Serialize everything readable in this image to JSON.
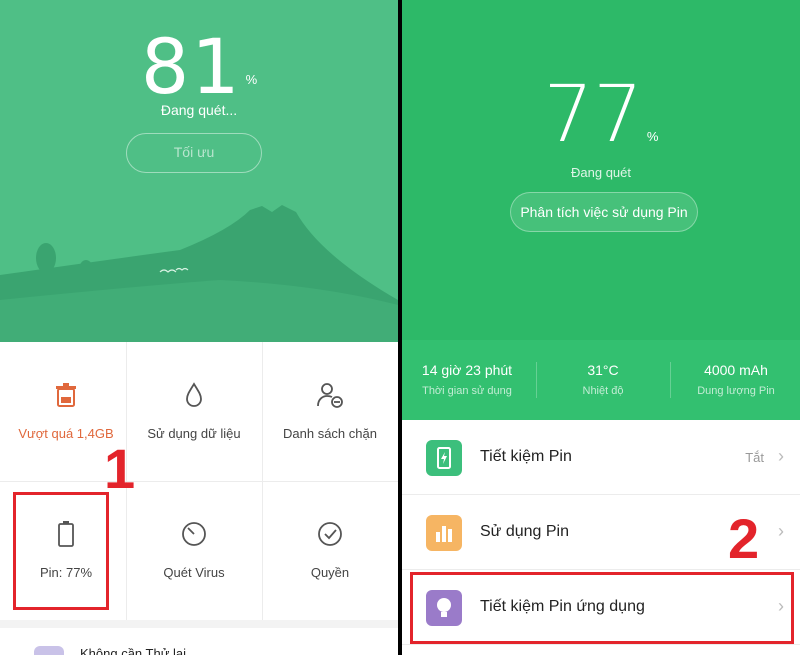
{
  "left": {
    "percent": "81",
    "percent_symbol": "%",
    "status": "Đang quét...",
    "optimize_label": "Tối ưu",
    "grid": [
      {
        "label": "Vượt quá 1,4GB",
        "icon": "trash-icon",
        "color": "#e0683c"
      },
      {
        "label": "Sử dụng dữ liệu",
        "icon": "water-drop-icon",
        "color": "#444444"
      },
      {
        "label": "Danh sách chặn",
        "icon": "block-user-icon",
        "color": "#444444"
      },
      {
        "label": "Pin: 77%",
        "icon": "battery-icon",
        "color": "#444444"
      },
      {
        "label": "Quét Virus",
        "icon": "timer-icon",
        "color": "#444444"
      },
      {
        "label": "Quyền",
        "icon": "check-circle-icon",
        "color": "#444444"
      }
    ],
    "bottom_text": "Không cần Thử lại",
    "step_label": "1"
  },
  "right": {
    "percent": "77",
    "percent_symbol": "%",
    "status": "Đang quét",
    "analyze_label": "Phân tích việc sử dụng Pin",
    "stats": [
      {
        "value": "14 giờ 23 phút",
        "label": "Thời gian sử dụng"
      },
      {
        "value": "31°C",
        "label": "Nhiệt độ"
      },
      {
        "value": "4000 mAh",
        "label": "Dung lượng Pin"
      }
    ],
    "rows": [
      {
        "label": "Tiết kiệm Pin",
        "value": "Tắt",
        "icon": "battery-saver-icon",
        "color": "#3cbf7c"
      },
      {
        "label": "Sử dụng Pin",
        "value": "",
        "icon": "bar-chart-icon",
        "color": "#f6b563"
      },
      {
        "label": "Tiết kiệm Pin ứng dụng",
        "value": "",
        "icon": "lightbulb-icon",
        "color": "#9a7bc9"
      }
    ],
    "chevron": "›",
    "step_label": "2"
  },
  "colors": {
    "left_hero": "#4fbf86",
    "right_hero": "#2db968",
    "highlight": "#e3242b"
  }
}
